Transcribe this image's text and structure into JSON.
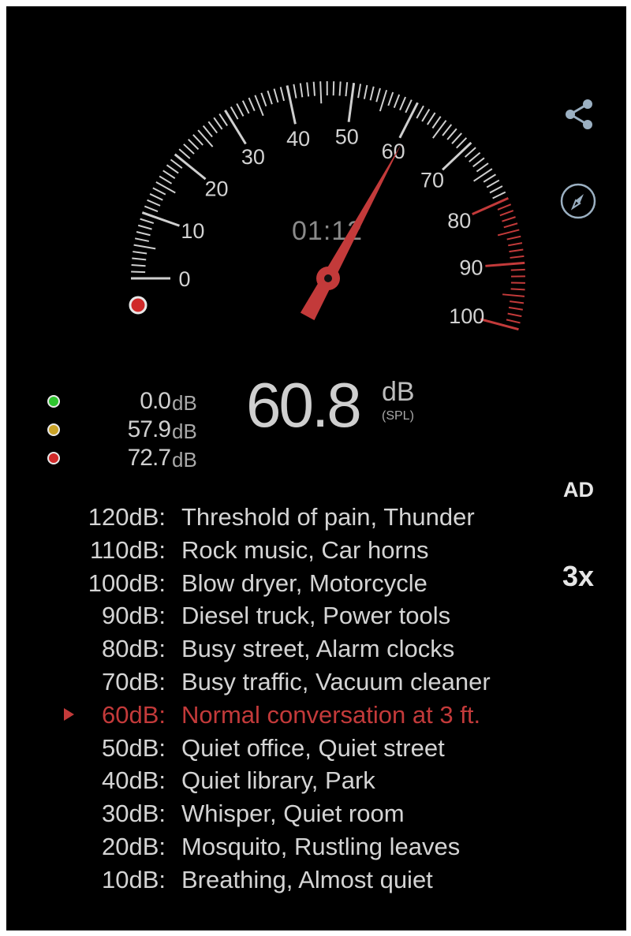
{
  "gauge": {
    "scale_labels": [
      "0",
      "10",
      "20",
      "30",
      "40",
      "50",
      "60",
      "70",
      "80",
      "90",
      "100"
    ],
    "needle_value_db": 60.8,
    "timer": "01:12",
    "danger_color": "#c33a3a"
  },
  "stats": {
    "min": {
      "value": "0.0",
      "unit": "dB",
      "color": "#2ec42e"
    },
    "avg": {
      "value": "57.9",
      "unit": "dB",
      "color": "#c9a227"
    },
    "max": {
      "value": "72.7",
      "unit": "dB",
      "color": "#d02a2a"
    }
  },
  "reading": {
    "value": "60.8",
    "unit": "dB",
    "subunit": "(SPL)"
  },
  "side_buttons": {
    "share_icon": "share-icon",
    "compass_icon": "compass-icon",
    "ad": "AD",
    "speed": "3x"
  },
  "reference_list": [
    {
      "db": "120dB:",
      "desc": "Threshold of pain, Thunder"
    },
    {
      "db": "110dB:",
      "desc": "Rock music, Car horns"
    },
    {
      "db": "100dB:",
      "desc": "Blow dryer, Motorcycle"
    },
    {
      "db": "90dB:",
      "desc": "Diesel truck, Power tools"
    },
    {
      "db": "80dB:",
      "desc": "Busy street, Alarm clocks"
    },
    {
      "db": "70dB:",
      "desc": "Busy traffic, Vacuum cleaner"
    },
    {
      "db": "60dB:",
      "desc": "Normal conversation at 3 ft.",
      "active": true
    },
    {
      "db": "50dB:",
      "desc": "Quiet office, Quiet street"
    },
    {
      "db": "40dB:",
      "desc": "Quiet library, Park"
    },
    {
      "db": "30dB:",
      "desc": "Whisper, Quiet room"
    },
    {
      "db": "20dB:",
      "desc": "Mosquito, Rustling leaves"
    },
    {
      "db": "10dB:",
      "desc": "Breathing, Almost quiet"
    }
  ]
}
